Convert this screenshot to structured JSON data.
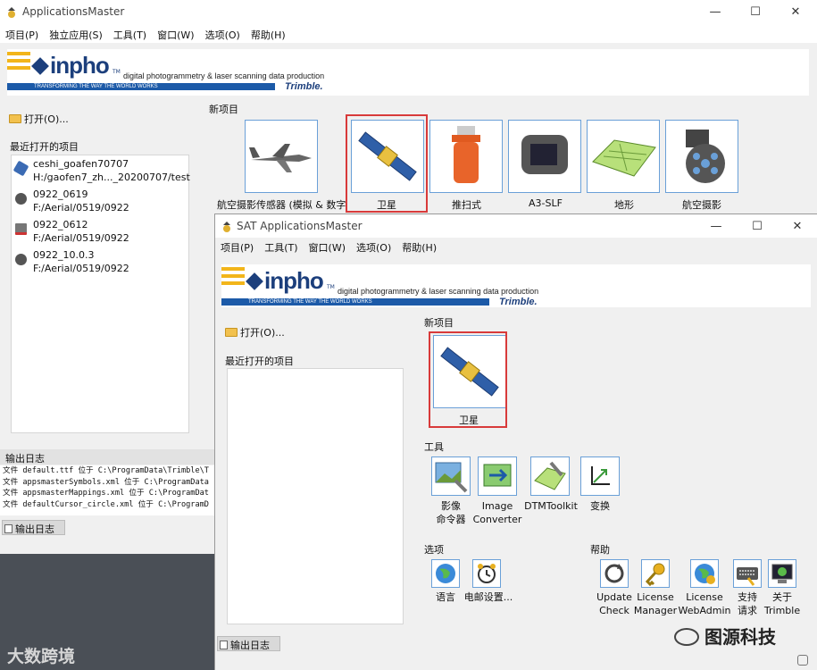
{
  "colors": {
    "accent_blue": "#1c5aa8",
    "highlight_red": "#d83a3a",
    "logo_yellow": "#f2b51a",
    "logo_navy": "#1c3f7c"
  },
  "back_window": {
    "title": "ApplicationsMaster",
    "menu": [
      "项目(P)",
      "独立应用(S)",
      "工具(T)",
      "窗口(W)",
      "选项(O)",
      "帮助(H)"
    ],
    "banner": {
      "logo": "inpho",
      "tm": "TM",
      "tagline": "digital photogrammetry & laser scanning data production",
      "strip": "TRANSFORMING THE WAY THE WORLD WORKS",
      "trimble": "Trimble."
    },
    "open_label": "打开(O)...",
    "recent_label": "最近打开的项目",
    "recent_items": [
      {
        "name": "ceshi_goafen70707",
        "path": "H:/gaofen7_zh..._20200707/test",
        "icon": "satellite-icon"
      },
      {
        "name": "0922_0619",
        "path": "F:/Aerial/0519/0922",
        "icon": "camera-icon"
      },
      {
        "name": "0922_0612",
        "path": "F:/Aerial/0519/0922",
        "icon": "computer-icon"
      },
      {
        "name": "0922_10.0.3",
        "path": "F:/Aerial/0519/0922",
        "icon": "camera-icon"
      }
    ],
    "new_project_label": "新项目",
    "new_project_tiles": [
      {
        "label": "航空摄影传感器 (模拟 & 数字",
        "icon": "airplane-icon"
      },
      {
        "label": "卫星",
        "icon": "satellite-icon"
      },
      {
        "label": "推扫式",
        "icon": "pushbroom-sensor-icon"
      },
      {
        "label": "A3-SLF",
        "icon": "a3-camera-icon"
      },
      {
        "label": "地形",
        "icon": "terrain-icon"
      },
      {
        "label": "航空摄影",
        "icon": "multi-lens-camera-icon"
      }
    ],
    "log_label": "输出日志",
    "log_lines": [
      "文件 default.ttf 位于 C:\\ProgramData\\Trimble\\T",
      "文件 appsmasterSymbols.xml 位于 C:\\ProgramData",
      "文件 appsmasterMappings.xml 位于 C:\\ProgramDat",
      "文件 defaultCursor_circle.xml 位于 C:\\ProgramD"
    ],
    "log_button": "输出日志",
    "window_controls": {
      "minimize": "—",
      "maximize": "☐",
      "close": "✕"
    }
  },
  "front_window": {
    "title": "SAT ApplicationsMaster",
    "menu": [
      "项目(P)",
      "工具(T)",
      "窗口(W)",
      "选项(O)",
      "帮助(H)"
    ],
    "open_label": "打开(O)...",
    "recent_label": "最近打开的项目",
    "new_project_label": "新项目",
    "satellite_label": "卫星",
    "tools_label": "工具",
    "tools": [
      {
        "label_lines": [
          "影像",
          "命令器"
        ],
        "icon": "image-commander-icon"
      },
      {
        "label_lines": [
          "Image",
          "Converter"
        ],
        "icon": "image-converter-icon"
      },
      {
        "label_lines": [
          "DTMToolkit"
        ],
        "icon": "dtm-toolkit-icon"
      },
      {
        "label_lines": [
          "变换"
        ],
        "icon": "transform-icon"
      }
    ],
    "options_label": "选项",
    "options": [
      {
        "label": "语言",
        "icon": "globe-icon"
      },
      {
        "label": "电邮设置...",
        "icon": "alarm-clock-icon"
      }
    ],
    "help_label": "帮助",
    "help": [
      {
        "label_lines": [
          "Update",
          "Check"
        ],
        "icon": "refresh-icon"
      },
      {
        "label_lines": [
          "License",
          "Manager"
        ],
        "icon": "key-icon"
      },
      {
        "label_lines": [
          "License",
          "WebAdmin"
        ],
        "icon": "web-globe-icon"
      },
      {
        "label_lines": [
          "支持",
          "请求"
        ],
        "icon": "keyboard-icon"
      },
      {
        "label_lines": [
          "关于",
          "Trimble"
        ],
        "icon": "about-icon"
      }
    ],
    "log_button": "输出日志",
    "window_controls": {
      "minimize": "—",
      "maximize": "☐",
      "close": "✕"
    }
  },
  "watermarks": {
    "left": "大数跨境",
    "right": "图源科技"
  }
}
